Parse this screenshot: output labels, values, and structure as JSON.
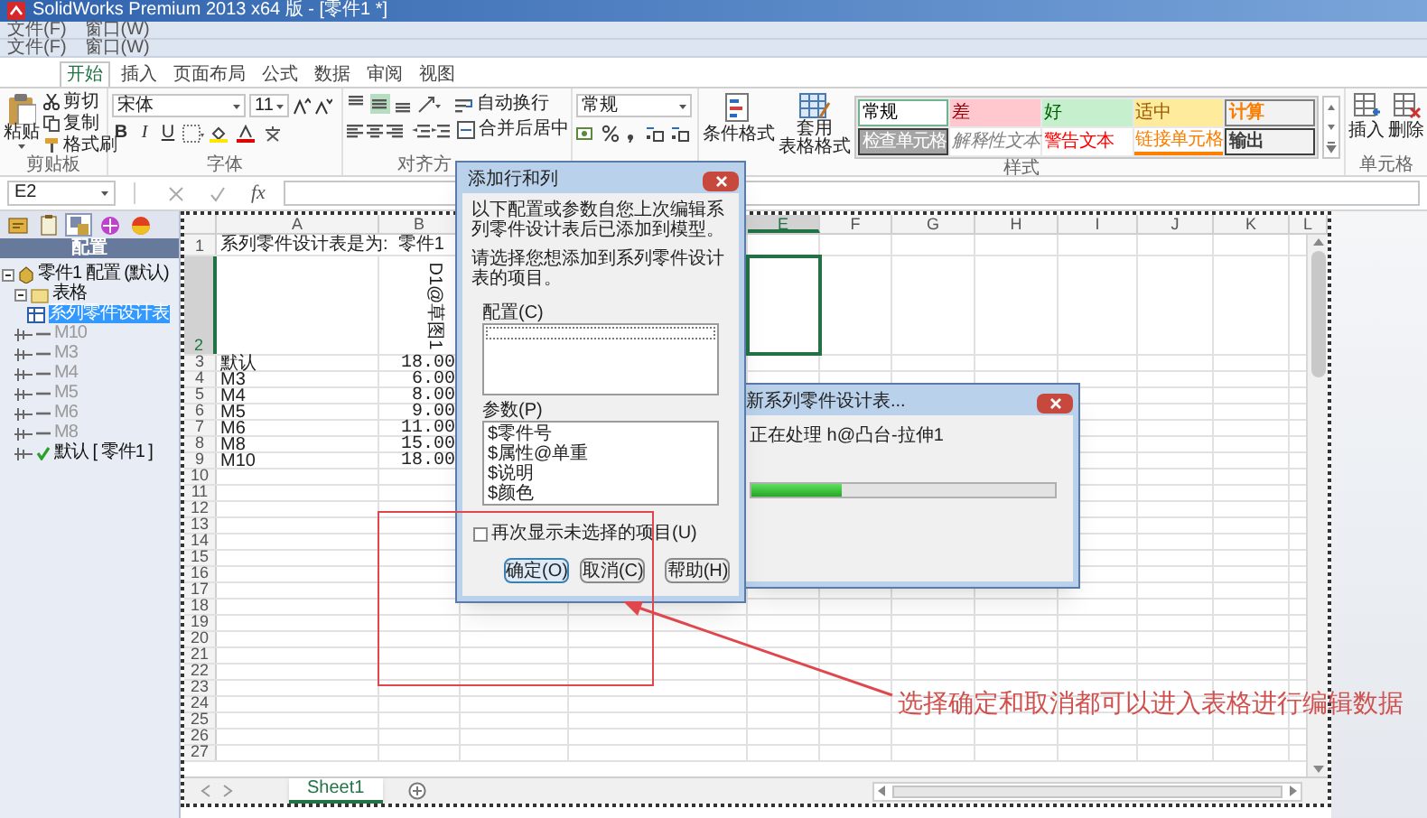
{
  "window": {
    "title": "SolidWorks Premium 2013 x64 版 - [零件1 *]"
  },
  "menu_bars": [
    {
      "items": [
        "文件(F)",
        "窗口(W)"
      ]
    },
    {
      "items": [
        "文件(F)",
        "窗口(W)"
      ]
    }
  ],
  "ribbon": {
    "tabs": [
      {
        "label": "开始",
        "selected": true
      },
      {
        "label": "插入",
        "selected": false
      },
      {
        "label": "页面布局",
        "selected": false
      },
      {
        "label": "公式",
        "selected": false
      },
      {
        "label": "数据",
        "selected": false
      },
      {
        "label": "审阅",
        "selected": false
      },
      {
        "label": "视图",
        "selected": false
      }
    ],
    "clipboard": {
      "paste": "粘贴",
      "cut": "剪切",
      "copy": "复制",
      "format_painter": "格式刷",
      "label": "剪贴板"
    },
    "font": {
      "name": "宋体",
      "size": "11",
      "styles": [
        "B",
        "I",
        "U"
      ],
      "label": "字体"
    },
    "alignment": {
      "vertical": [
        {
          "kind": "top",
          "selected": false
        },
        {
          "kind": "middle",
          "selected": true
        },
        {
          "kind": "bottom",
          "selected": false
        }
      ],
      "horizontal": [
        {
          "kind": "left",
          "selected": false
        },
        {
          "kind": "center",
          "selected": false
        },
        {
          "kind": "right",
          "selected": false
        }
      ],
      "wrap": "自动换行",
      "merge": "合并后居中",
      "label": "对齐方"
    },
    "number": {
      "format": "常规"
    },
    "styles": {
      "conditional": "条件格式",
      "table": [
        "套用",
        "表格格式"
      ],
      "label": "样式",
      "gallery": [
        {
          "label": "常规",
          "kind": "normal"
        },
        {
          "label": "差",
          "kind": "bad"
        },
        {
          "label": "好",
          "kind": "good"
        },
        {
          "label": "适中",
          "kind": "neutral"
        },
        {
          "label": "计算",
          "kind": "calculation"
        },
        {
          "label": "检查单元格",
          "kind": "check"
        },
        {
          "label": "解释性文本",
          "kind": "explanatory"
        },
        {
          "label": "警告文本",
          "kind": "warning"
        },
        {
          "label": "链接单元格",
          "kind": "linked"
        },
        {
          "label": "输出",
          "kind": "output"
        }
      ]
    },
    "cells": {
      "insert": "插入",
      "delete": "删除",
      "label": "单元格"
    }
  },
  "formula_bar": {
    "name_box": "E2",
    "function_label": "fx"
  },
  "config_manager": {
    "tabs": [
      {
        "kind": "features",
        "selected": false
      },
      {
        "kind": "properties",
        "selected": false
      },
      {
        "kind": "configurations",
        "selected": true
      },
      {
        "kind": "dimxpert",
        "selected": false
      },
      {
        "kind": "appearance",
        "selected": false
      }
    ],
    "header": "配置",
    "tree": [
      {
        "label": "零件1 配置 (默认)",
        "kind": "root",
        "selected": false,
        "children": [
          {
            "label": "表格",
            "kind": "folder",
            "selected": false,
            "children": [
              {
                "label": "系列零件设计表",
                "kind": "table",
                "selected": true
              }
            ]
          },
          {
            "label": "M10",
            "kind": "config",
            "active": false,
            "selected": false
          },
          {
            "label": "M3",
            "kind": "config",
            "active": false,
            "selected": false
          },
          {
            "label": "M4",
            "kind": "config",
            "active": false,
            "selected": false
          },
          {
            "label": "M5",
            "kind": "config",
            "active": false,
            "selected": false
          },
          {
            "label": "M6",
            "kind": "config",
            "active": false,
            "selected": false
          },
          {
            "label": "M8",
            "kind": "config",
            "active": false,
            "selected": false
          },
          {
            "label": "默认 [ 零件1 ]",
            "kind": "config",
            "active": true,
            "selected": false
          }
        ]
      }
    ]
  },
  "sheet": {
    "columns": [
      {
        "kind": "letter",
        "label": "A",
        "selected": false
      },
      {
        "kind": "letter",
        "label": "B",
        "selected": false
      },
      {
        "kind": "covered"
      },
      {
        "kind": "covered"
      },
      {
        "kind": "letter",
        "label": "E",
        "selected": true
      },
      {
        "kind": "letter",
        "label": "F",
        "selected": false
      },
      {
        "kind": "letter",
        "label": "G",
        "selected": false
      },
      {
        "kind": "letter",
        "label": "H",
        "selected": false
      },
      {
        "kind": "letter",
        "label": "I",
        "selected": false
      },
      {
        "kind": "letter",
        "label": "J",
        "selected": false
      },
      {
        "kind": "letter",
        "label": "K",
        "selected": false
      },
      {
        "kind": "letter",
        "label": "L",
        "selected": false
      }
    ],
    "rows": [
      {
        "number": "1",
        "kind": "title",
        "selected": false,
        "a": "系列零件设计表是为:  零件1"
      },
      {
        "number": "2",
        "kind": "header",
        "selected": true,
        "b": "D1@草图1"
      },
      {
        "number": "3",
        "kind": "data",
        "selected": false,
        "a": "默认",
        "b": "18.00"
      },
      {
        "number": "4",
        "kind": "data",
        "selected": false,
        "a": "M3",
        "b": "6.00"
      },
      {
        "number": "5",
        "kind": "data",
        "selected": false,
        "a": "M4",
        "b": "8.00"
      },
      {
        "number": "6",
        "kind": "data",
        "selected": false,
        "a": "M5",
        "b": "9.00"
      },
      {
        "number": "7",
        "kind": "data",
        "selected": false,
        "a": "M6",
        "b": "11.00"
      },
      {
        "number": "8",
        "kind": "data",
        "selected": false,
        "a": "M8",
        "b": "15.00"
      },
      {
        "number": "9",
        "kind": "data",
        "selected": false,
        "a": "M10",
        "b": "18.00"
      },
      {
        "number": "10",
        "kind": "empty",
        "selected": false
      },
      {
        "number": "11",
        "kind": "empty",
        "selected": false
      },
      {
        "number": "12",
        "kind": "empty",
        "selected": false
      },
      {
        "number": "13",
        "kind": "empty",
        "selected": false
      },
      {
        "number": "14",
        "kind": "empty",
        "selected": false
      },
      {
        "number": "15",
        "kind": "empty",
        "selected": false
      },
      {
        "number": "16",
        "kind": "empty",
        "selected": false
      },
      {
        "number": "17",
        "kind": "empty",
        "selected": false
      },
      {
        "number": "18",
        "kind": "empty",
        "selected": false
      },
      {
        "number": "19",
        "kind": "empty",
        "selected": false
      },
      {
        "number": "20",
        "kind": "empty",
        "selected": false
      },
      {
        "number": "21",
        "kind": "empty",
        "selected": false
      },
      {
        "number": "22",
        "kind": "empty",
        "selected": false
      },
      {
        "number": "23",
        "kind": "empty",
        "selected": false
      },
      {
        "number": "24",
        "kind": "empty",
        "selected": false
      },
      {
        "number": "25",
        "kind": "empty",
        "selected": false
      },
      {
        "number": "26",
        "kind": "empty",
        "selected": false
      },
      {
        "number": "27",
        "kind": "empty",
        "selected": false
      }
    ],
    "tabs": [
      {
        "label": "Sheet1",
        "selected": true
      }
    ]
  },
  "add_rows_dialog": {
    "title": "添加行和列",
    "message": "以下配置或参数自您上次编辑系列零件设计表后已添加到模型。",
    "prompt": "请选择您想添加到系列零件设计表的项目。",
    "configurations": {
      "label": "配置(C)"
    },
    "parameters": {
      "label": "参数(P)",
      "items": [
        "$零件号",
        "$属性@单重",
        "$说明",
        "$颜色"
      ]
    },
    "checkbox": {
      "label": "再次显示未选择的项目(U)",
      "checked": false
    },
    "buttons": [
      {
        "label": "确定(O)",
        "kind": "default"
      },
      {
        "label": "取消(C)",
        "kind": "normal"
      },
      {
        "label": "帮助(H)",
        "kind": "normal"
      }
    ]
  },
  "progress_dialog": {
    "title": "新系列零件设计表...",
    "message": "正在处理 h@凸台-拉伸1",
    "level": 0.3
  },
  "annotation": {
    "text": "选择确定和取消都可以进入表格进行编辑数据"
  }
}
